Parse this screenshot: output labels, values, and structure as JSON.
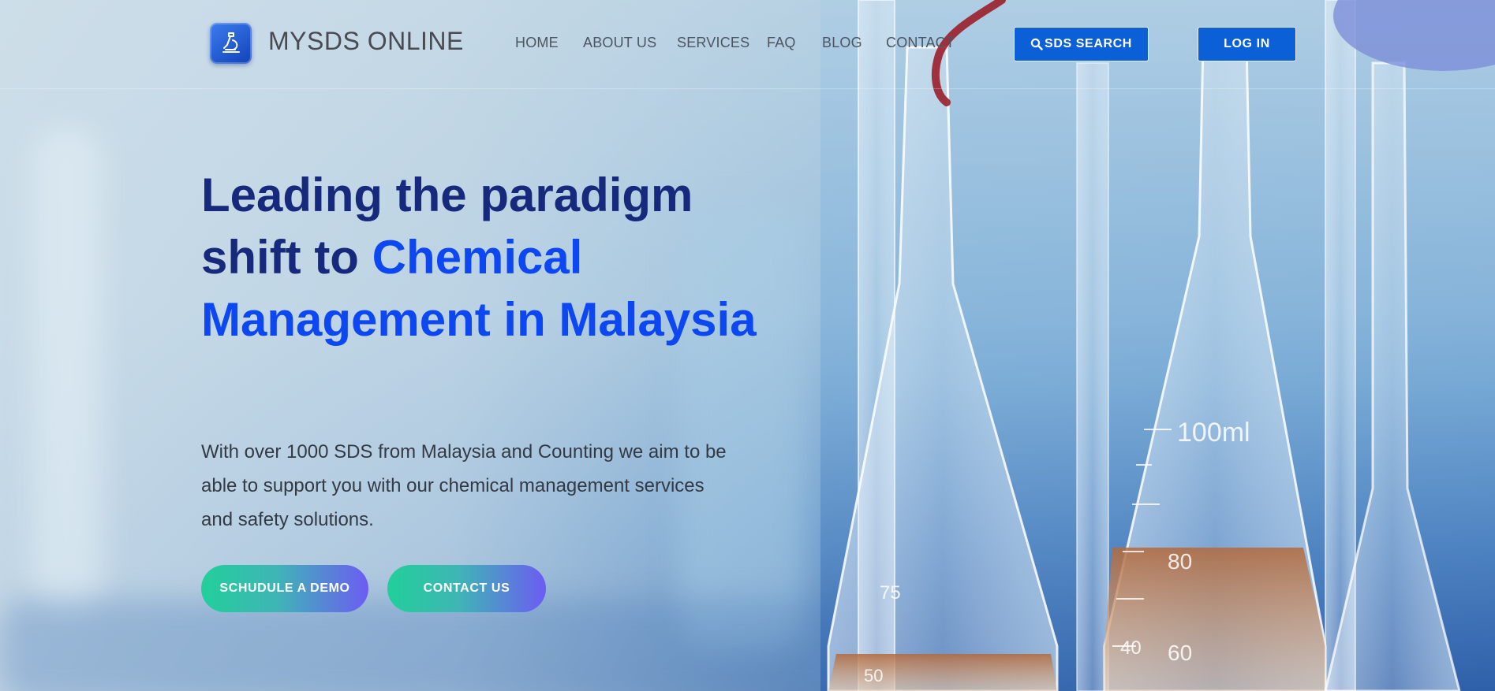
{
  "brand": {
    "name": "MYSDS ONLINE",
    "logo_icon": "microscope-icon",
    "accent_color": "#0b5fd7"
  },
  "nav": {
    "items": [
      {
        "label": "HOME"
      },
      {
        "label": "ABOUT US"
      },
      {
        "label": "SERVICES"
      },
      {
        "label": "FAQ"
      },
      {
        "label": "BLOG"
      },
      {
        "label": "CONTACT"
      }
    ],
    "sds_search_label": "SDS SEARCH",
    "sds_search_icon": "search-icon",
    "login_label": "LOG IN"
  },
  "hero": {
    "headline_part1": "Leading the paradigm shift to ",
    "headline_accent": "Chemical Management in Malaysia",
    "subtext": "With over 1000 SDS from Malaysia and Counting we aim to be able to support you with our chemical management services and safety solutions.",
    "cta_demo": "SCHUDULE A DEMO",
    "cta_contact": "CONTACT US",
    "headline_color": "#16297c",
    "headline_accent_color": "#0d47f2"
  },
  "background": {
    "image": "laboratory-glassware-photo",
    "glass_markings": [
      "100ml",
      "80",
      "60",
      "75",
      "40",
      "50"
    ]
  }
}
